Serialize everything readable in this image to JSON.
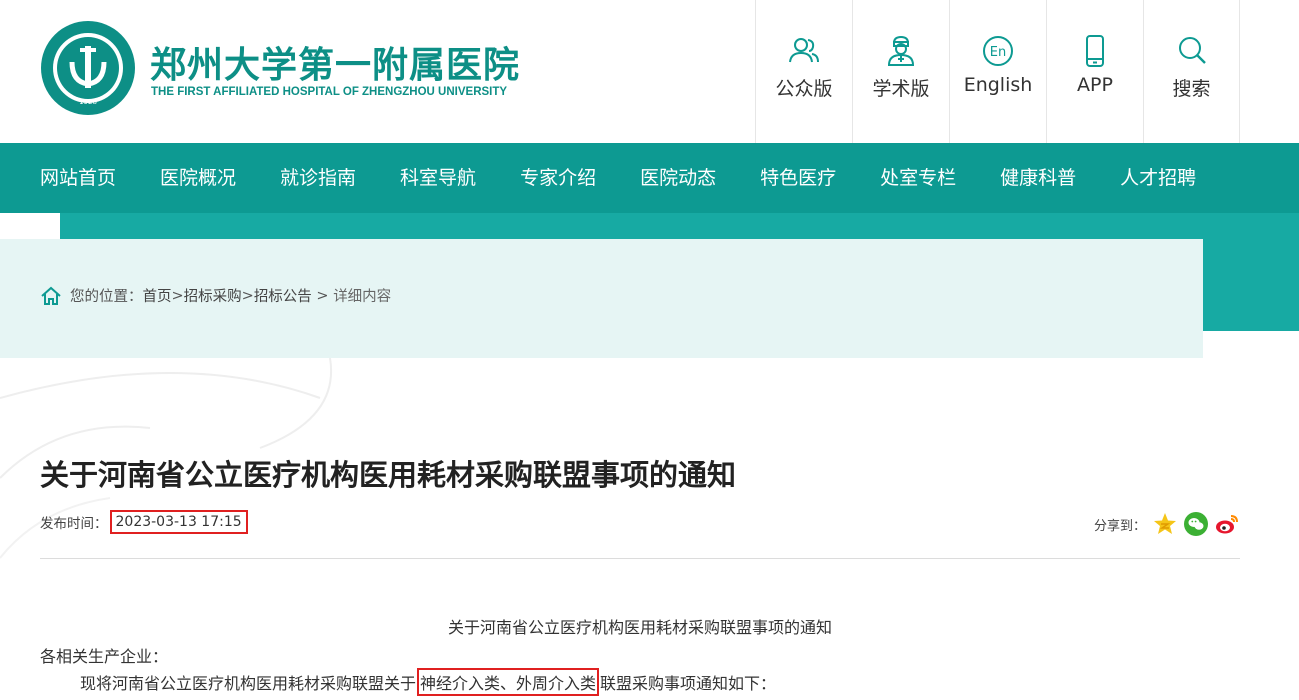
{
  "header": {
    "brand_cn": "郑州大学第一附属医院",
    "brand_en": "THE FIRST AFFILIATED HOSPITAL OF ZHENGZHOU UNIVERSITY",
    "logo_year": "1928",
    "quick_links": [
      {
        "label": "公众版",
        "icon": "users-icon"
      },
      {
        "label": "学术版",
        "icon": "doctor-icon"
      },
      {
        "label": "English",
        "icon": "en-icon",
        "icon_text": "En"
      },
      {
        "label": "APP",
        "icon": "phone-icon"
      },
      {
        "label": "搜索",
        "icon": "search-icon"
      }
    ]
  },
  "nav": {
    "items": [
      "网站首页",
      "医院概况",
      "就诊指南",
      "科室导航",
      "专家介绍",
      "医院动态",
      "特色医疗",
      "处室专栏",
      "健康科普",
      "人才招聘"
    ]
  },
  "breadcrumb": {
    "prefix": "您的位置：",
    "home": "首页",
    "sep1": " >",
    "level1": "招标采购",
    "sep2": ">",
    "level2": "招标公告",
    "sep3": " > ",
    "current": "详细内容"
  },
  "article": {
    "title": "关于河南省公立医疗机构医用耗材采购联盟事项的通知",
    "publish_label": "发布时间：",
    "publish_time": "2023-03-13 17:15",
    "share_label": "分享到：",
    "body_title": "关于河南省公立医疗机构医用耗材采购联盟事项的通知",
    "greeting": "各相关生产企业：",
    "line1_pre": "现将河南省公立医疗机构医用耗材采购联盟关于",
    "line1_highlight": "神经介入类、外周介入类",
    "line1_post": "联盟采购事项通知如下："
  },
  "colors": {
    "primary": "#0d9a92",
    "band_dark": "#17aaa3",
    "band_light": "#e6f5f4",
    "highlight_box": "#e02020"
  }
}
